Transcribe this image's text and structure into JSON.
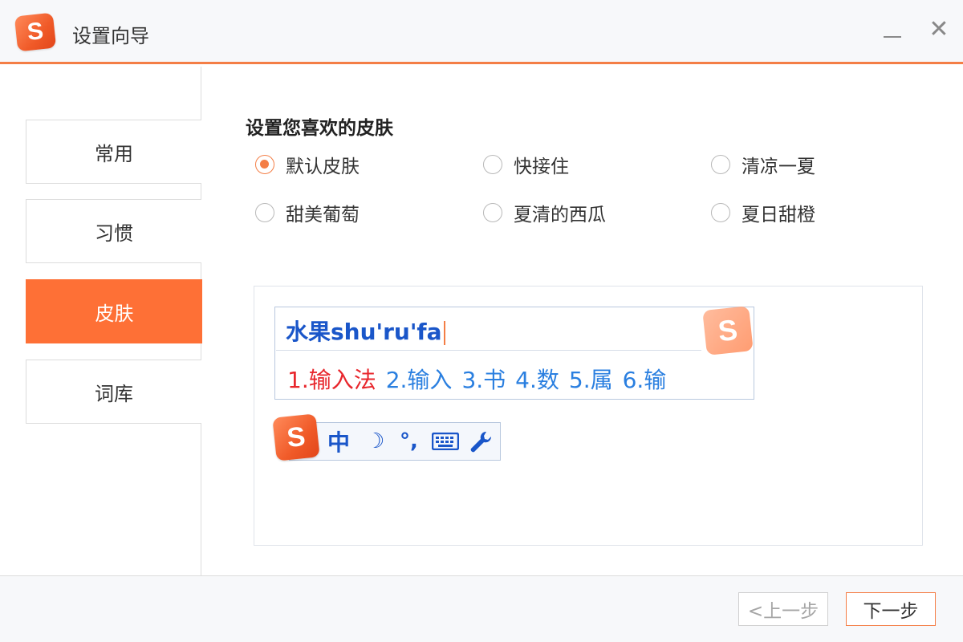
{
  "window": {
    "logo_letter": "S",
    "title": "设置向导",
    "minimize_symbol": "",
    "close_symbol": "✕"
  },
  "sidebar": {
    "items": [
      {
        "label": "常用",
        "active": false
      },
      {
        "label": "习惯",
        "active": false
      },
      {
        "label": "皮肤",
        "active": true
      },
      {
        "label": "词库",
        "active": false
      }
    ]
  },
  "main": {
    "section_title": "设置您喜欢的皮肤",
    "skins": [
      {
        "label": "默认皮肤",
        "selected": true
      },
      {
        "label": "快接住",
        "selected": false
      },
      {
        "label": "清凉一夏",
        "selected": false
      },
      {
        "label": "甜美葡萄",
        "selected": false
      },
      {
        "label": "夏清的西瓜",
        "selected": false
      },
      {
        "label": "夏日甜橙",
        "selected": false
      }
    ],
    "preview": {
      "composition": "水果shu'ru'fa",
      "candidates": [
        "1.输入法",
        "2.输入",
        "3.书",
        "4.数",
        "5.属",
        "6.输"
      ],
      "logo_letter": "S",
      "status_bar": {
        "logo_letter": "S",
        "mode": "中",
        "moon_icon": "☽",
        "punct_icon": "°,",
        "keyboard_icon": "⌨",
        "tool_icon": "🔧"
      }
    }
  },
  "footer": {
    "prev_label": "<上一步",
    "next_label": "下一步"
  },
  "colors": {
    "accent": "#fe7036",
    "link_blue": "#2a7fe0",
    "first_candidate": "#e8262c"
  }
}
